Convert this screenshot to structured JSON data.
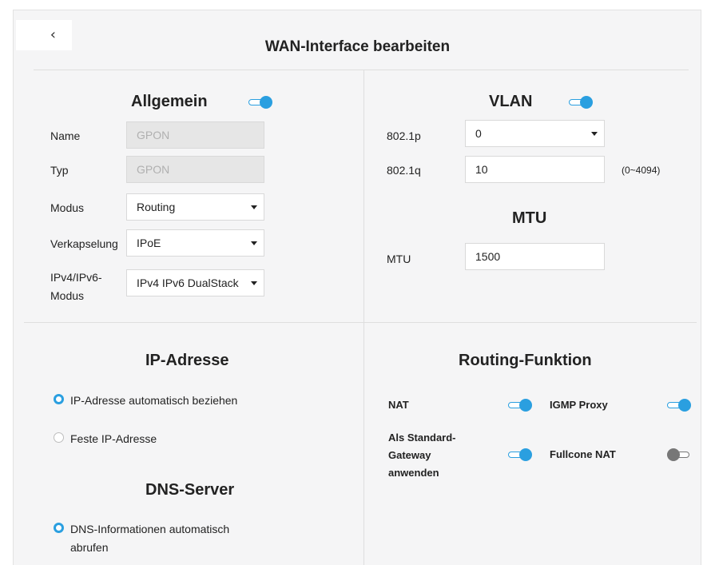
{
  "header": {
    "back_glyph": "‹",
    "title": "WAN-Interface bearbeiten"
  },
  "allgemein": {
    "title": "Allgemein",
    "toggle_on": true,
    "name_label": "Name",
    "name_value": "GPON",
    "typ_label": "Typ",
    "typ_value": "GPON",
    "modus_label": "Modus",
    "modus_value": "Routing",
    "verkapselung_label": "Verkapselung",
    "verkapselung_value": "IPoE",
    "ipmode_label": "IPv4/IPv6-\nModus",
    "ipmode_value": "IPv4 IPv6 DualStack"
  },
  "vlan": {
    "title": "VLAN",
    "toggle_on": true,
    "p_label": "802.1p",
    "p_value": "0",
    "q_label": "802.1q",
    "q_value": "10",
    "q_hint": "(0~4094)"
  },
  "mtu": {
    "title": "MTU",
    "label": "MTU",
    "value": "1500"
  },
  "ip_address": {
    "title": "IP-Adresse",
    "option_auto": "IP-Adresse automatisch beziehen",
    "option_fixed": "Feste IP-Adresse",
    "selected": "auto"
  },
  "dns": {
    "title": "DNS-Server",
    "option_auto": "DNS-Informationen automatisch\nabrufen",
    "selected": "auto"
  },
  "routing": {
    "title": "Routing-Funktion",
    "nat_label": "NAT",
    "nat_on": true,
    "igmp_label": "IGMP Proxy",
    "igmp_on": true,
    "gateway_label": "Als Standard-\nGateway\nanwenden",
    "gateway_on": true,
    "fullcone_label": "Fullcone NAT",
    "fullcone_on": false
  },
  "colors": {
    "accent": "#2a9fe0",
    "toggle_off": "#777777"
  }
}
